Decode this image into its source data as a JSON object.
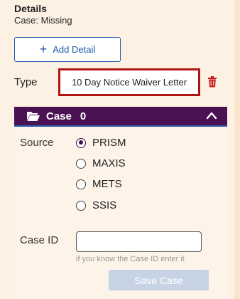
{
  "header": {
    "title": "Details",
    "subtitle": "Case: Missing"
  },
  "add_detail_button": {
    "icon": "plus-icon",
    "label": "Add Detail"
  },
  "type_field": {
    "label": "Type",
    "value": "10 Day Notice Waiver Letter",
    "delete_icon": "trash-icon"
  },
  "case_section": {
    "title": "Case",
    "count": "0",
    "header_icon": "folder-open-icon",
    "collapse_icon": "chevron-up-icon",
    "colors": {
      "header_bg": "#4a1252",
      "header_border": "#2a5aa8"
    },
    "source": {
      "label": "Source",
      "options": [
        "PRISM",
        "MAXIS",
        "METS",
        "SSIS"
      ],
      "selected": "PRISM"
    },
    "case_id": {
      "label": "Case ID",
      "value": "",
      "hint": "if you know the Case ID enter it"
    },
    "save_button": {
      "label": "Save Case",
      "enabled": false
    }
  }
}
